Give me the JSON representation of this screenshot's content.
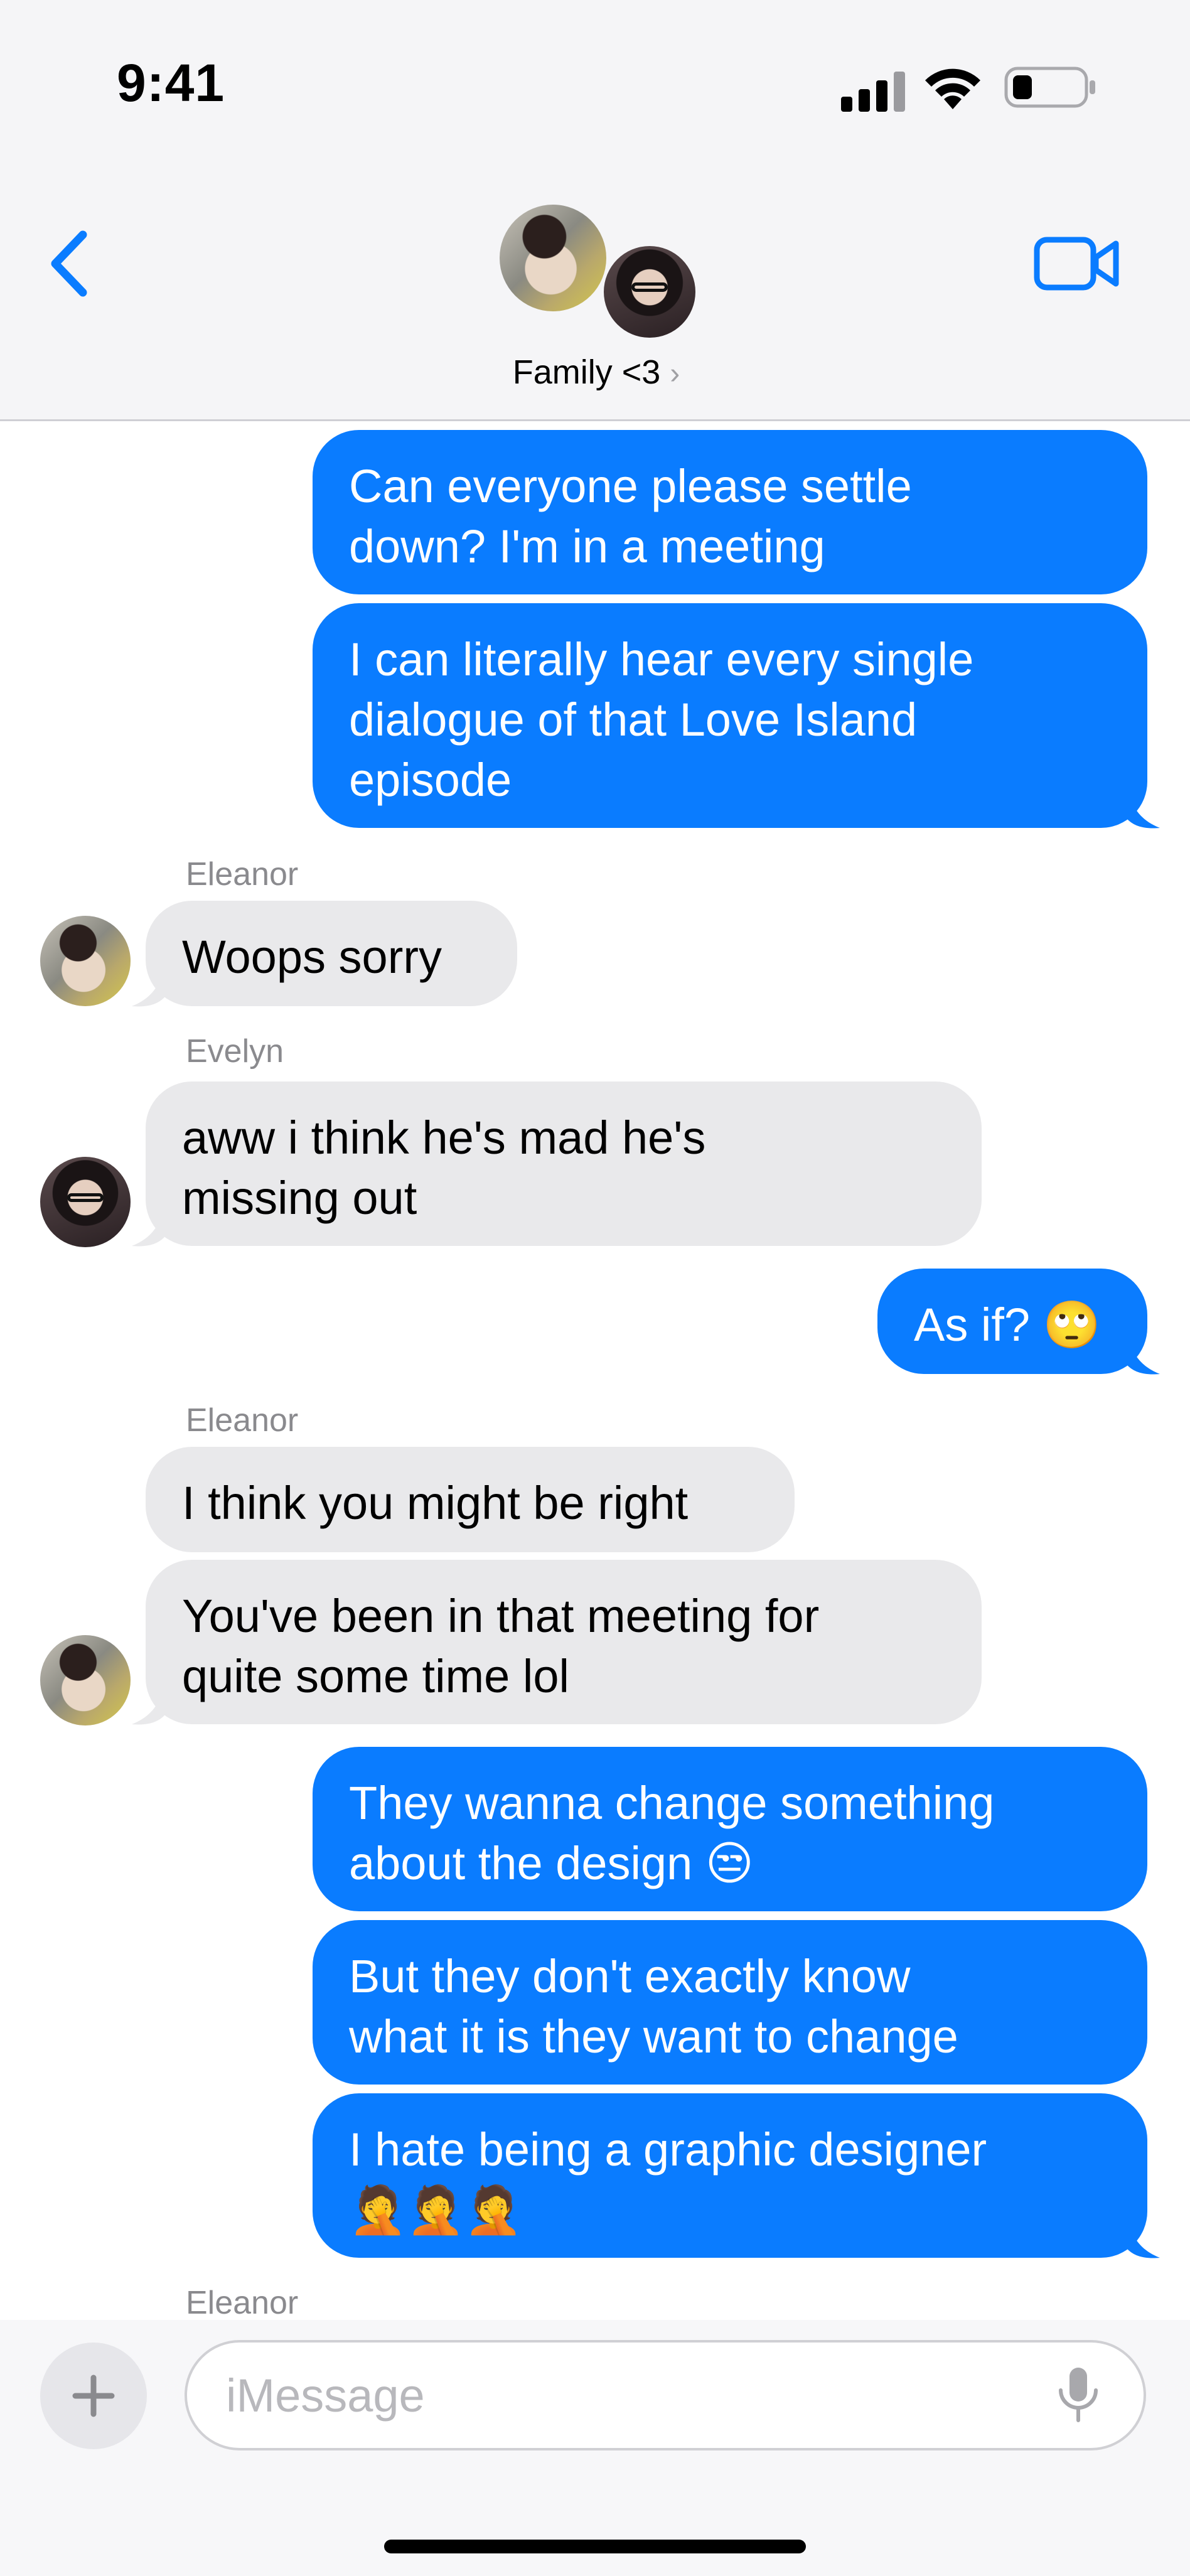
{
  "status_bar": {
    "time": "9:41"
  },
  "header": {
    "title": "Family <3"
  },
  "messages": {
    "m1": "Can everyone please settle\ndown? I'm in a meeting",
    "m2": "I can literally hear every single\ndialogue of that Love Island\nepisode",
    "m3_sender": "Eleanor",
    "m3": "Woops sorry",
    "m4_sender": "Evelyn",
    "m4": "aww i think he's mad he's\nmissing out",
    "m5": "As if? 🙄",
    "m6_sender": "Eleanor",
    "m6": "I think you might be right",
    "m7": "You've been in that meeting for\nquite some time lol",
    "m8": "They wanna change something\nabout the design 😒",
    "m9": "But they don't exactly know\nwhat it is they want to change",
    "m10": "I hate being a graphic designer\n🤦🤦🤦",
    "typing_sender": "Eleanor"
  },
  "composer": {
    "placeholder": "iMessage"
  },
  "colors": {
    "accent": "#0a7cff",
    "incoming": "#e9e9eb",
    "header_bg": "#f5f5f7"
  }
}
